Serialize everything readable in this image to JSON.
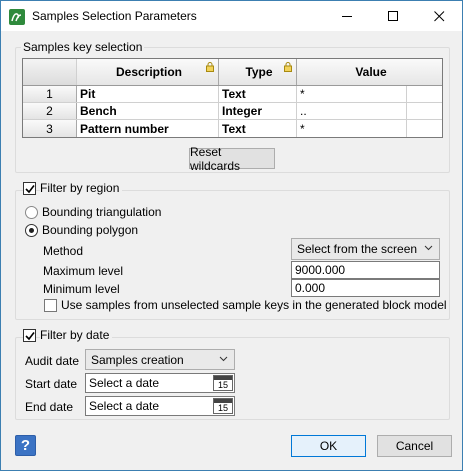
{
  "window": {
    "title": "Samples Selection Parameters"
  },
  "samples_key": {
    "group_label": "Samples key selection",
    "columns": [
      "Description",
      "Type",
      "Value"
    ],
    "rows": [
      {
        "num": "1",
        "description": "Pit",
        "type": "Text",
        "value": "*"
      },
      {
        "num": "2",
        "description": "Bench",
        "type": "Integer",
        "value": ".."
      },
      {
        "num": "3",
        "description": "Pattern number",
        "type": "Text",
        "value": "*"
      }
    ],
    "reset_label": "Reset wildcards"
  },
  "region": {
    "checkbox_label": "Filter by region",
    "checked": true,
    "radio_triangulation": "Bounding triangulation",
    "radio_polygon": "Bounding polygon",
    "method_label": "Method",
    "method_value": "Select from the screen",
    "max_label": "Maximum level",
    "max_value": "9000.000",
    "min_label": "Minimum level",
    "min_value": "0.000",
    "use_unselected_label": "Use samples from unselected sample keys in the generated block model"
  },
  "date": {
    "checkbox_label": "Filter by date",
    "checked": true,
    "audit_label": "Audit date",
    "audit_value": "Samples creation",
    "start_label": "Start date",
    "start_placeholder": "Select a date",
    "end_label": "End date",
    "end_placeholder": "Select a date",
    "calendar_day": "15"
  },
  "footer": {
    "help": "?",
    "ok": "OK",
    "cancel": "Cancel"
  }
}
